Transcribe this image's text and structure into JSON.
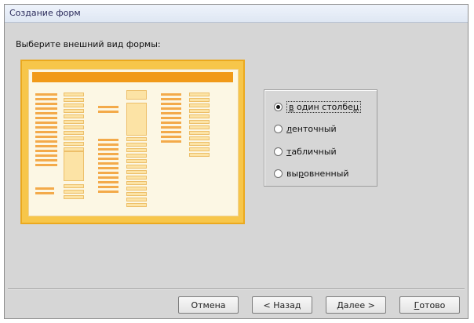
{
  "window": {
    "title": "Создание форм"
  },
  "prompt": "Выберите внешний вид формы:",
  "layouts": [
    {
      "before": "",
      "acc": "в",
      "after": " один столбе",
      "acc2": "ц",
      "selected": true
    },
    {
      "before": "",
      "acc": "л",
      "after": "енточный",
      "acc2": "",
      "selected": false
    },
    {
      "before": "",
      "acc": "т",
      "after": "абличный",
      "acc2": "",
      "selected": false
    },
    {
      "before": "вы",
      "acc": "р",
      "after": "овненный",
      "acc2": "",
      "selected": false
    }
  ],
  "buttons": {
    "cancel": "Отмена",
    "back_pre": "< Наза",
    "back_acc": "д",
    "next_acc": "Д",
    "next_post": "алее >",
    "finish_acc": "Г",
    "finish_post": "отово"
  }
}
